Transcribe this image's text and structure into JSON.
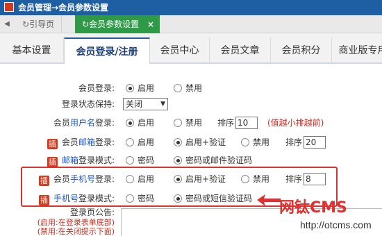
{
  "window": {
    "title": "会员管理→会员参数设置"
  },
  "top_tabs": {
    "home": "引导页",
    "active": "会员参数设置",
    "close": "×"
  },
  "sub_tabs": [
    "基本设置",
    "会员登录/注册",
    "会员中心",
    "会员文章",
    "会员积分",
    "商业版专用"
  ],
  "rows": {
    "login": {
      "label": "会员登录:",
      "opt1": "启用",
      "opt2": "禁用"
    },
    "keep": {
      "label": "登录状态保持:",
      "value": "关闭"
    },
    "username": {
      "pre": "会员",
      "hl": "用户名",
      "post": "登录:",
      "opt1": "启用",
      "opt2": "禁用",
      "sort_label": "排序",
      "sort_value": "10",
      "note": "(值越小排越前)"
    },
    "email_login": {
      "ins": "插",
      "pre": "会员",
      "hl": "邮箱",
      "post": "登录:",
      "opt1": "启用",
      "opt2": "启用+验证",
      "opt3": "禁用",
      "sort_label": "排序",
      "sort_value": "20"
    },
    "email_mode": {
      "ins": "插",
      "hl": "邮箱",
      "post": "登录模式:",
      "opt1": "密码",
      "opt2": "密码或邮件验证码"
    },
    "phone_login": {
      "ins": "插",
      "pre": "会员",
      "hl": "手机号",
      "post": "登录:",
      "opt1": "启用",
      "opt2": "启用+验证",
      "opt3": "禁用",
      "sort_label": "排序",
      "sort_value": "8"
    },
    "phone_mode": {
      "ins": "插",
      "hl": "手机号",
      "post": "登录模式:",
      "opt1": "密码",
      "opt2": "密码或短信验证码"
    },
    "notice": {
      "label": "登录页公告:",
      "line1": "(启用:在登录表单底部)",
      "line2": "(禁用:在关闭提示下面)"
    }
  },
  "watermark": {
    "brand": "网钛CMS",
    "url": "http://otcms.com"
  },
  "colors": {
    "title_bar": "#1e5fa3",
    "active_tab": "#2e9a48",
    "highlight": "#e03030",
    "note": "#d42a1e"
  }
}
